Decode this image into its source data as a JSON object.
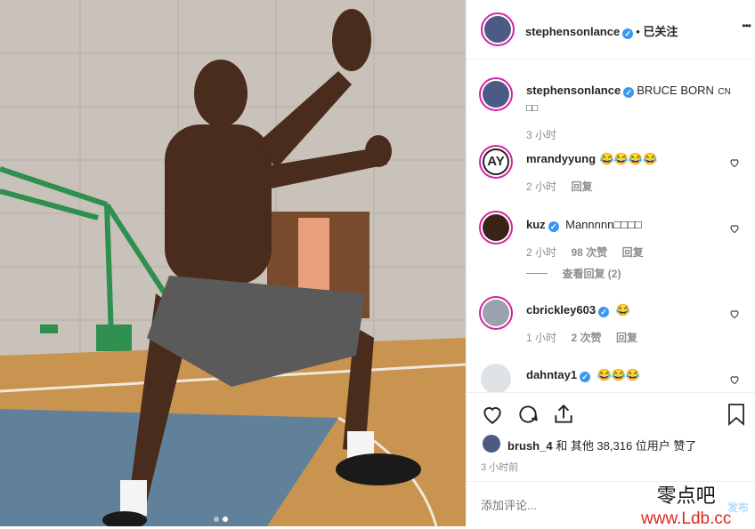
{
  "header": {
    "username": "stephensonlance",
    "separator": "•",
    "follow_status": "已关注",
    "more": "•••"
  },
  "caption": {
    "username": "stephensonlance",
    "text": "BRUCE BORN",
    "suffix_1": "CN",
    "suffix_2": "□□",
    "time": "3 小时"
  },
  "comments": [
    {
      "username": "mrandyyung",
      "text": "😂😂😂😂",
      "time": "2 小时",
      "reply": "回复",
      "verified": false
    },
    {
      "username": "kuz",
      "text": "Mannnnn□□□□",
      "time": "2 小时",
      "likes": "98 次赞",
      "reply": "回复",
      "verified": true,
      "view_replies": "查看回复 (2)"
    },
    {
      "username": "cbrickley603",
      "text": "😂",
      "time": "1 小时",
      "likes": "2 次赞",
      "reply": "回复",
      "verified": true
    },
    {
      "username": "dahntay1",
      "text": "😂😂😂",
      "verified": true
    }
  ],
  "actions": {
    "liked_by_user": "brush_4",
    "liked_by_text": "和 其他 38,316 位用户 赞了",
    "time": "3 小时前"
  },
  "comment_box": {
    "placeholder": "添加评论...",
    "post_label": "发布"
  },
  "watermark": {
    "line1": "零点吧",
    "line2": "www.Ldb.cc"
  },
  "colors": {
    "verified": "#3897f0",
    "story_ring": "#d6249f",
    "post_link": "#b3dbff",
    "watermark_red": "#e0281e"
  },
  "icons": [
    "heart-icon",
    "comment-icon",
    "share-icon",
    "bookmark-icon",
    "more-icon"
  ],
  "carousel": {
    "count": 2,
    "active": 2
  }
}
